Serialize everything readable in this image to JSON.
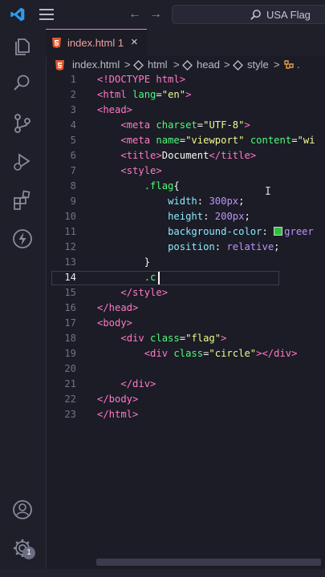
{
  "titlebar": {
    "search_text": "USA Flag"
  },
  "tab": {
    "label": "index.html",
    "problems": "1",
    "close": "×"
  },
  "breadcrumb": {
    "file": "index.html",
    "sep": ">",
    "html": "html",
    "head": "head",
    "style": "style",
    "tail": "."
  },
  "accounts_badge": "1",
  "colors": {
    "tag": "#ff79c6",
    "attr": "#50fa7b",
    "string": "#f1fa8c",
    "property": "#8be9fd",
    "number": "#bd93f9"
  },
  "lines": [
    {
      "n": "1",
      "indent": "",
      "parts": [
        {
          "c": "tg",
          "t": "<!DOCTYPE html>"
        }
      ]
    },
    {
      "n": "2",
      "indent": "",
      "parts": [
        {
          "c": "tg",
          "t": "<html "
        },
        {
          "c": "at",
          "t": "lang"
        },
        {
          "c": "pl",
          "t": "="
        },
        {
          "c": "st",
          "t": "\"en\""
        },
        {
          "c": "tg",
          "t": ">"
        }
      ]
    },
    {
      "n": "3",
      "indent": "",
      "parts": [
        {
          "c": "tg",
          "t": "<head>"
        }
      ]
    },
    {
      "n": "4",
      "indent": "    ",
      "parts": [
        {
          "c": "tg",
          "t": "<meta "
        },
        {
          "c": "at",
          "t": "charset"
        },
        {
          "c": "pl",
          "t": "="
        },
        {
          "c": "st",
          "t": "\"UTF-8\""
        },
        {
          "c": "tg",
          "t": ">"
        }
      ]
    },
    {
      "n": "5",
      "indent": "    ",
      "parts": [
        {
          "c": "tg",
          "t": "<meta "
        },
        {
          "c": "at",
          "t": "name"
        },
        {
          "c": "pl",
          "t": "="
        },
        {
          "c": "st",
          "t": "\"viewport\" "
        },
        {
          "c": "at",
          "t": "content"
        },
        {
          "c": "pl",
          "t": "="
        },
        {
          "c": "st",
          "t": "\"wi"
        }
      ]
    },
    {
      "n": "6",
      "indent": "    ",
      "parts": [
        {
          "c": "tg",
          "t": "<title>"
        },
        {
          "c": "pl",
          "t": "Document"
        },
        {
          "c": "tg",
          "t": "</title>"
        }
      ]
    },
    {
      "n": "7",
      "indent": "    ",
      "parts": [
        {
          "c": "tg",
          "t": "<style>"
        }
      ]
    },
    {
      "n": "8",
      "indent": "        ",
      "parts": [
        {
          "c": "sel",
          "t": ".flag"
        },
        {
          "c": "pl",
          "t": "{"
        }
      ]
    },
    {
      "n": "9",
      "indent": "            ",
      "parts": [
        {
          "c": "pr",
          "t": "width"
        },
        {
          "c": "pl",
          "t": ": "
        },
        {
          "c": "nm",
          "t": "300px"
        },
        {
          "c": "pl",
          "t": ";"
        }
      ]
    },
    {
      "n": "10",
      "indent": "            ",
      "parts": [
        {
          "c": "pr",
          "t": "height"
        },
        {
          "c": "pl",
          "t": ": "
        },
        {
          "c": "nm",
          "t": "200px"
        },
        {
          "c": "pl",
          "t": ";"
        }
      ]
    },
    {
      "n": "11",
      "indent": "            ",
      "swatch": true,
      "parts": [
        {
          "c": "pr",
          "t": "background-color"
        },
        {
          "c": "pl",
          "t": ": "
        },
        {
          "c": "sw",
          "t": ""
        },
        {
          "c": "nm",
          "t": "greer"
        }
      ]
    },
    {
      "n": "12",
      "indent": "            ",
      "parts": [
        {
          "c": "pr",
          "t": "position"
        },
        {
          "c": "pl",
          "t": ": "
        },
        {
          "c": "nm",
          "t": "relative"
        },
        {
          "c": "pl",
          "t": ";"
        }
      ]
    },
    {
      "n": "13",
      "indent": "        ",
      "parts": [
        {
          "c": "pl",
          "t": "}"
        }
      ]
    },
    {
      "n": "14",
      "indent": "        ",
      "active": true,
      "parts": [
        {
          "c": "sel",
          "t": ".c"
        }
      ]
    },
    {
      "n": "15",
      "indent": "    ",
      "parts": [
        {
          "c": "tg",
          "t": "</style>"
        }
      ]
    },
    {
      "n": "16",
      "indent": "",
      "parts": [
        {
          "c": "tg",
          "t": "</head>"
        }
      ]
    },
    {
      "n": "17",
      "indent": "",
      "parts": [
        {
          "c": "tg",
          "t": "<body>"
        }
      ]
    },
    {
      "n": "18",
      "indent": "    ",
      "parts": [
        {
          "c": "tg",
          "t": "<div "
        },
        {
          "c": "at",
          "t": "class"
        },
        {
          "c": "pl",
          "t": "="
        },
        {
          "c": "st",
          "t": "\"flag\""
        },
        {
          "c": "tg",
          "t": ">"
        }
      ]
    },
    {
      "n": "19",
      "indent": "        ",
      "parts": [
        {
          "c": "tg",
          "t": "<div "
        },
        {
          "c": "at",
          "t": "class"
        },
        {
          "c": "pl",
          "t": "="
        },
        {
          "c": "st",
          "t": "\"circle\""
        },
        {
          "c": "tg",
          "t": "></div>"
        }
      ]
    },
    {
      "n": "20",
      "indent": "",
      "parts": []
    },
    {
      "n": "21",
      "indent": "    ",
      "parts": [
        {
          "c": "tg",
          "t": "</div>"
        }
      ]
    },
    {
      "n": "22",
      "indent": "",
      "parts": [
        {
          "c": "tg",
          "t": "</body>"
        }
      ]
    },
    {
      "n": "23",
      "indent": "",
      "parts": [
        {
          "c": "tg",
          "t": "</html>"
        }
      ]
    }
  ]
}
